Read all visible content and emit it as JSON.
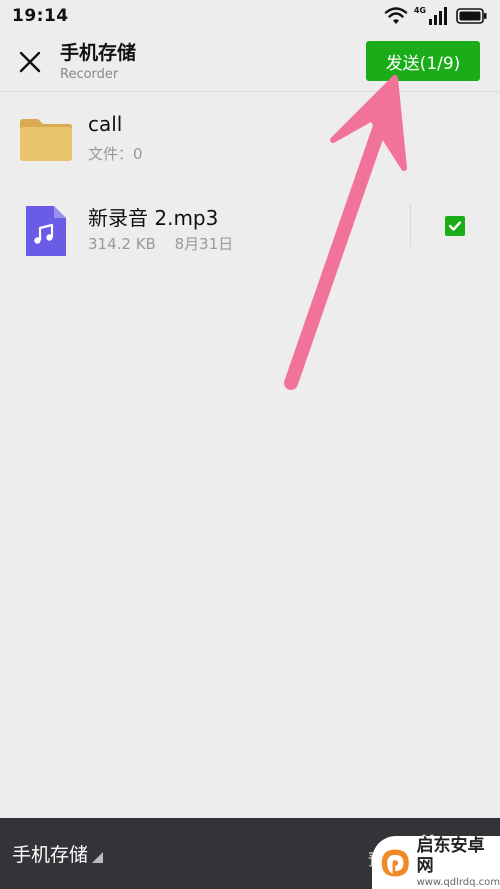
{
  "status_bar": {
    "time": "19:14",
    "network_label": "4G",
    "icons": [
      "wifi-icon",
      "cellular-signal-icon",
      "battery-icon"
    ]
  },
  "header": {
    "title": "手机存储",
    "subtitle": "Recorder",
    "send_label": "发送(1/9)"
  },
  "files": [
    {
      "name": "call",
      "type": "folder",
      "meta": [
        "文件：0"
      ],
      "icon": "folder-icon"
    },
    {
      "name": "新录音 2.mp3",
      "type": "audio",
      "meta": [
        "314.2 KB",
        "8月31日"
      ],
      "icon": "music-file-icon",
      "selected": true
    }
  ],
  "bottom_bar": {
    "storage_label": "手机存储",
    "right_glyph": "预"
  },
  "watermark": {
    "brand": "启东安卓网",
    "url": "www.qdlrdq.com"
  },
  "colors": {
    "accent_green": "#1aad19",
    "folder_yellow": "#e9c46a",
    "audio_file_purple": "#6a5ce6",
    "arrow_pink": "#f2739a",
    "bottom_bar": "#333437",
    "background": "#ededed"
  }
}
